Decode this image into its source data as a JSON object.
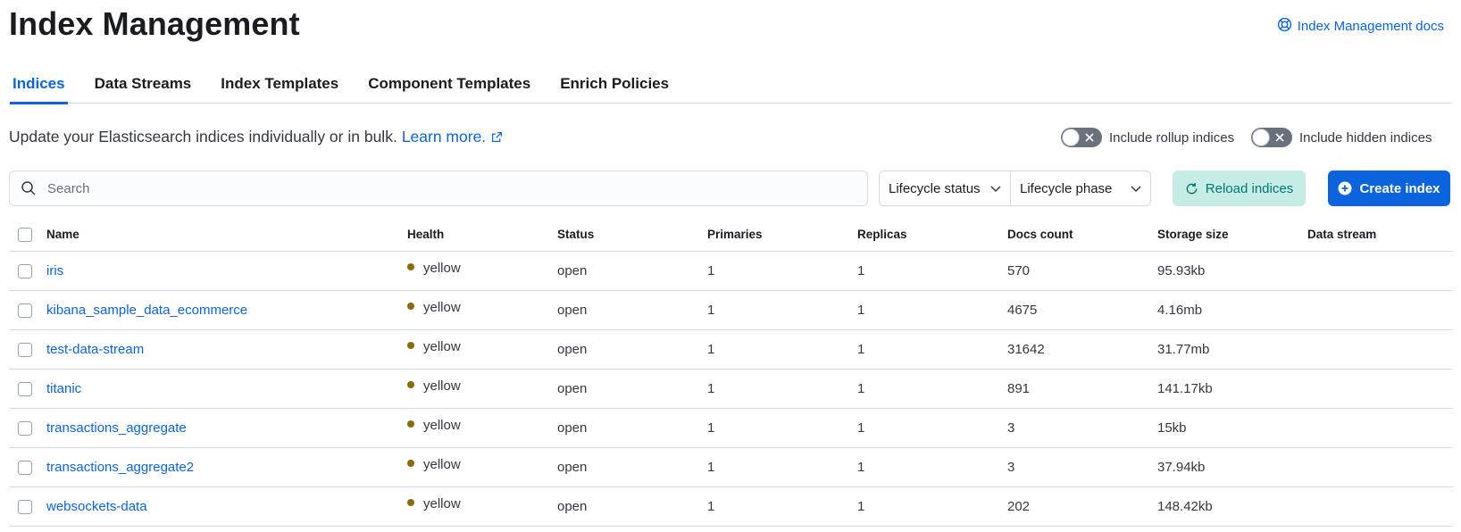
{
  "header": {
    "title": "Index Management",
    "docs_link": "Index Management docs"
  },
  "tabs": [
    {
      "label": "Indices",
      "active": true
    },
    {
      "label": "Data Streams",
      "active": false
    },
    {
      "label": "Index Templates",
      "active": false
    },
    {
      "label": "Component Templates",
      "active": false
    },
    {
      "label": "Enrich Policies",
      "active": false
    }
  ],
  "description": {
    "text": "Update your Elasticsearch indices individually or in bulk.",
    "learn_more": "Learn more."
  },
  "toggles": {
    "rollup_label": "Include rollup indices",
    "hidden_label": "Include hidden indices",
    "rollup_on": false,
    "hidden_on": false
  },
  "search": {
    "placeholder": "Search"
  },
  "filters": {
    "lifecycle_status": "Lifecycle status",
    "lifecycle_phase": "Lifecycle phase"
  },
  "actions": {
    "reload": "Reload indices",
    "create": "Create index"
  },
  "colors": {
    "accent": "#0b64dd",
    "health_yellow": "#8a6a0a",
    "reload_bg": "#c6ece6",
    "reload_text": "#007871"
  },
  "table": {
    "columns": {
      "name": "Name",
      "health": "Health",
      "status": "Status",
      "primaries": "Primaries",
      "replicas": "Replicas",
      "docs_count": "Docs count",
      "storage_size": "Storage size",
      "data_stream": "Data stream"
    },
    "rows": [
      {
        "name": "iris",
        "health": "yellow",
        "status": "open",
        "primaries": "1",
        "replicas": "1",
        "docs_count": "570",
        "storage_size": "95.93kb",
        "data_stream": ""
      },
      {
        "name": "kibana_sample_data_ecommerce",
        "health": "yellow",
        "status": "open",
        "primaries": "1",
        "replicas": "1",
        "docs_count": "4675",
        "storage_size": "4.16mb",
        "data_stream": ""
      },
      {
        "name": "test-data-stream",
        "health": "yellow",
        "status": "open",
        "primaries": "1",
        "replicas": "1",
        "docs_count": "31642",
        "storage_size": "31.77mb",
        "data_stream": ""
      },
      {
        "name": "titanic",
        "health": "yellow",
        "status": "open",
        "primaries": "1",
        "replicas": "1",
        "docs_count": "891",
        "storage_size": "141.17kb",
        "data_stream": ""
      },
      {
        "name": "transactions_aggregate",
        "health": "yellow",
        "status": "open",
        "primaries": "1",
        "replicas": "1",
        "docs_count": "3",
        "storage_size": "15kb",
        "data_stream": ""
      },
      {
        "name": "transactions_aggregate2",
        "health": "yellow",
        "status": "open",
        "primaries": "1",
        "replicas": "1",
        "docs_count": "3",
        "storage_size": "37.94kb",
        "data_stream": ""
      },
      {
        "name": "websockets-data",
        "health": "yellow",
        "status": "open",
        "primaries": "1",
        "replicas": "1",
        "docs_count": "202",
        "storage_size": "148.42kb",
        "data_stream": ""
      }
    ]
  }
}
